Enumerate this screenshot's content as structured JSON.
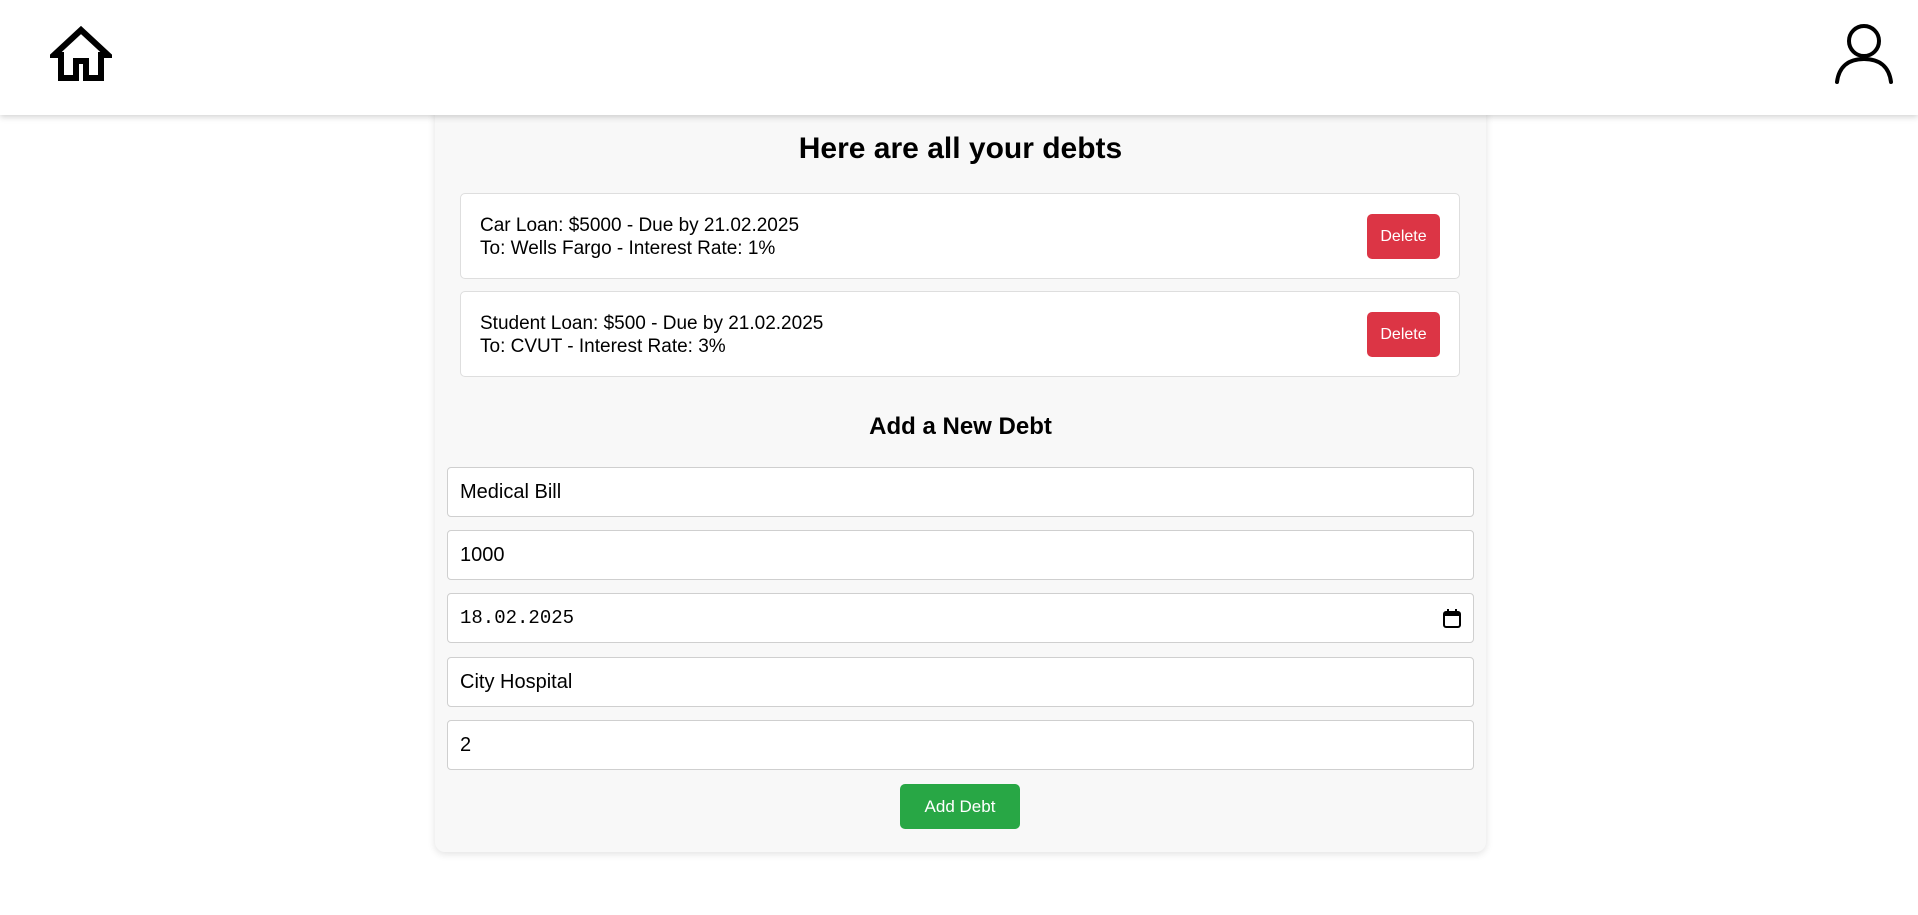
{
  "nav": {
    "home_icon": "home-icon",
    "profile_icon": "user-icon"
  },
  "debts": {
    "title": "Here are all your debts",
    "items": [
      {
        "line1": "Car Loan: $5000 - Due by 21.02.2025",
        "line2": "To: Wells Fargo - Interest Rate: 1%",
        "delete_label": "Delete"
      },
      {
        "line1": "Student Loan: $500 - Due by 21.02.2025",
        "line2": "To: CVUT - Interest Rate: 3%",
        "delete_label": "Delete"
      }
    ]
  },
  "form": {
    "title": "Add a New Debt",
    "name_value": "Medical Bill",
    "amount_value": "1000",
    "date_value": "18.02.2025",
    "creditor_value": "City Hospital",
    "interest_value": "2",
    "submit_label": "Add Debt"
  },
  "colors": {
    "delete": "#dc3545",
    "add": "#28a745",
    "panel_bg": "#f8f8f8"
  }
}
